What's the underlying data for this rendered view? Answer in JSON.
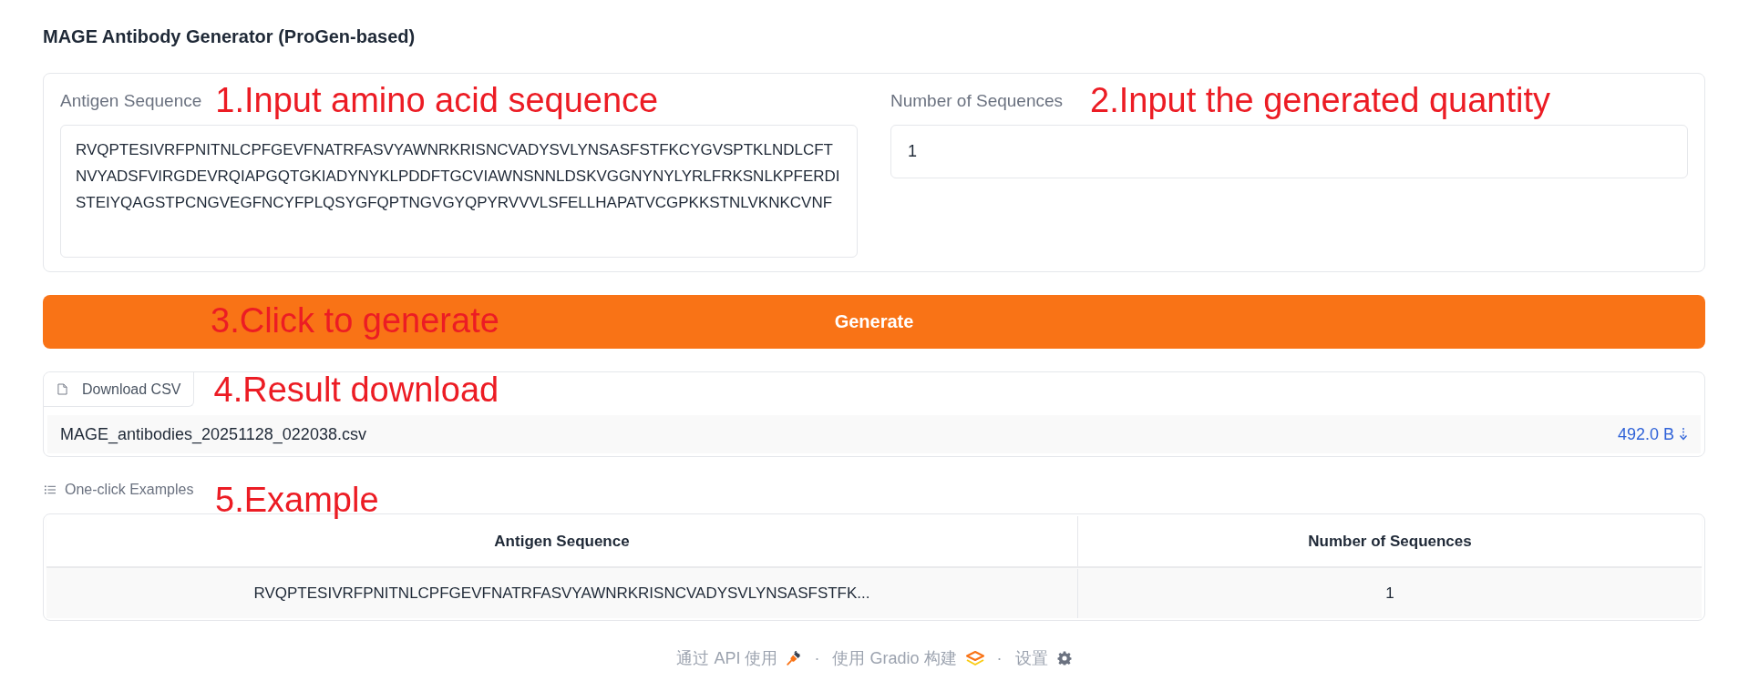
{
  "title": "MAGE Antibody Generator (ProGen-based)",
  "inputs": [
    {
      "kind": "textarea",
      "label": "Antigen Sequence",
      "value": "RVQPTESIVRFPNITNLCPFGEVFNATRFASVYAWNRKRISNCVADYSVLYNSASFSTFKCYGVSPTKLNDLCFTNVYADSFVIRGDEVRQIAPGQTGKIADYNYKLPDDFTGCVIAWNSNNLDSKVGGNYNYLYRLFRKSNLKPFERDISTEIYQAGSTPCNGVEGFNCYFPLQSYGFQPTNGVGYQPYRVVVLSFELLHAPATVCGPKKSTNLVKNKCVNF",
      "annotation": "1.Input amino acid sequence"
    },
    {
      "kind": "number",
      "label": "Number of Sequences",
      "value": "1",
      "annotation": "2.Input the generated quantity"
    }
  ],
  "generate": {
    "label": "Generate",
    "annotation": "3.Click to generate"
  },
  "download": {
    "button": "Download CSV",
    "annotation": "4.Result download",
    "file_name": "MAGE_antibodies_20251128_022038.csv",
    "file_size": "492.0 B"
  },
  "examples": {
    "label": "One-click Examples",
    "annotation": "5.Example",
    "columns": [
      "Antigen Sequence",
      "Number of Sequences"
    ],
    "rows": [
      [
        "RVQPTESIVRFPNITNLCPFGEVFNATRFASVYAWNRKRISNCVADYSVLYNSASFSTFK...",
        "1"
      ]
    ]
  },
  "footer": [
    {
      "kind": "api",
      "text": "通过 API 使用"
    },
    {
      "kind": "separator",
      "text": "·"
    },
    {
      "kind": "gradio",
      "text": "使用 Gradio 构建"
    },
    {
      "kind": "separator",
      "text": "·"
    },
    {
      "kind": "settings",
      "text": "设置"
    }
  ]
}
